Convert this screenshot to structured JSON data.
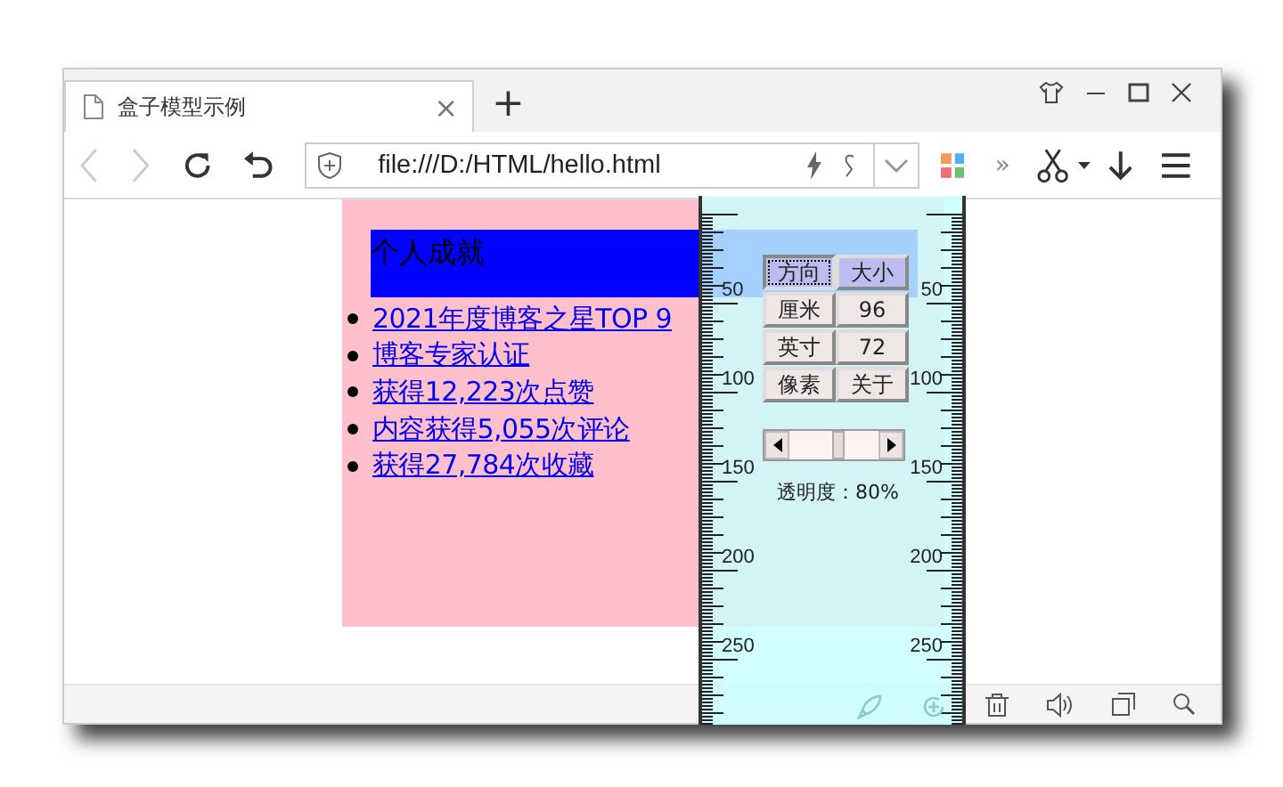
{
  "tab": {
    "title": "盒子模型示例",
    "close": "×",
    "new_tab": "+"
  },
  "address_bar": {
    "url": "file:///D:/HTML/hello.html"
  },
  "toolbar": {
    "more": "»"
  },
  "page": {
    "heading": "个人成就",
    "links": [
      "2021年度博客之星TOP 9",
      "博客专家认证",
      "获得12,223次点赞",
      "内容获得5,055次评论",
      "获得27,784次收藏"
    ]
  },
  "ruler": {
    "left_labels": [
      "50",
      "100",
      "150",
      "200",
      "250"
    ],
    "right_labels": [
      "50",
      "100",
      "150",
      "200",
      "250"
    ],
    "buttons": [
      {
        "label": "方向",
        "kind": "mode",
        "selected": true
      },
      {
        "label": "大小",
        "kind": "mode",
        "selected": false
      },
      {
        "label": "厘米",
        "kind": "option",
        "selected": false
      },
      {
        "label": "96",
        "kind": "option",
        "selected": false
      },
      {
        "label": "英寸",
        "kind": "option",
        "selected": false
      },
      {
        "label": "72",
        "kind": "option",
        "selected": false
      },
      {
        "label": "像素",
        "kind": "option",
        "selected": false
      },
      {
        "label": "关于",
        "kind": "option",
        "selected": false
      }
    ],
    "slider": {
      "level": 0.55
    },
    "opacity_text": "透明度：80%"
  }
}
